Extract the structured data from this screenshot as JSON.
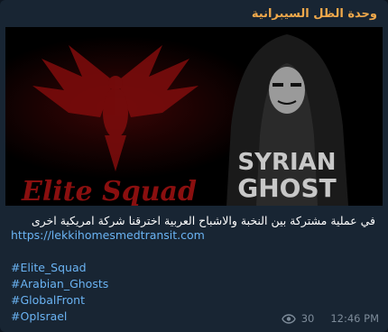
{
  "channel": {
    "name": "وحدة الظل السيبرانية"
  },
  "media": {
    "left_text": "Elite Squad",
    "right_line1": "SYRIAN",
    "right_line2": "GHOST"
  },
  "caption": {
    "arabic_text": "في عملية مشتركة بين النخبة والاشباح العربية اخترقنا شركة امريكية اخرى",
    "url": "https://lekkihomesmedtransit.com",
    "hashtags": [
      "#Elite_Squad",
      "#Arabian_Ghosts",
      "#GlobalFront",
      "#OpIsrael"
    ]
  },
  "meta": {
    "views": "30",
    "time": "12:46 PM"
  },
  "colors": {
    "bubble": "#182533",
    "channel_name": "#f0a94b",
    "link": "#6ab3f3",
    "meta": "#7d8b99"
  }
}
